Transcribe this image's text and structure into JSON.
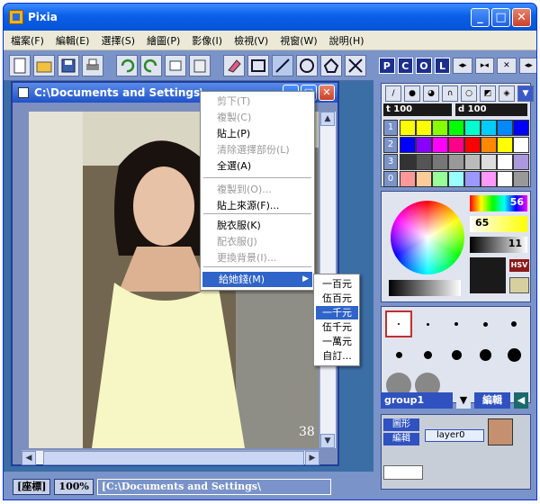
{
  "app": {
    "title": "Pixia"
  },
  "menu": [
    "檔案(F)",
    "編輯(E)",
    "選擇(S)",
    "繪圖(P)",
    "影像(I)",
    "檢視(V)",
    "視窗(W)",
    "說明(H)"
  ],
  "right_toolbar": {
    "p": "P",
    "c": "C",
    "o": "O",
    "l": "L"
  },
  "document": {
    "title": "C:\\Documents and Settings\\",
    "photo_label": "38"
  },
  "status": {
    "coord": "[座標]",
    "zoom": "100%",
    "path": "[C:\\Documents and Settings\\"
  },
  "color_panel": {
    "t_label": "t",
    "t_value": "100",
    "d_label": "d",
    "d_value": "100",
    "row_labels": [
      "1",
      "2",
      "3",
      "0"
    ],
    "r_value": "56",
    "g_value": "65",
    "b_value": "11",
    "mode": "HSV"
  },
  "layer_panel": {
    "group": "group1",
    "edit": "編輯",
    "shape": "圖形",
    "edit2": "編輯",
    "layer_name": "layer0"
  },
  "context_menu": {
    "items": [
      {
        "label": "剪下(T)",
        "disabled": true
      },
      {
        "label": "複製(C)",
        "disabled": true
      },
      {
        "label": "貼上(P)",
        "disabled": false
      },
      {
        "label": "清除選擇部份(L)",
        "disabled": true
      },
      {
        "label": "全選(A)",
        "disabled": false
      },
      {
        "label": "複製到(O)...",
        "disabled": true
      },
      {
        "label": "貼上來源(F)...",
        "disabled": false
      },
      {
        "label": "脫衣服(K)",
        "disabled": false
      },
      {
        "label": "配衣服(J)",
        "disabled": true
      },
      {
        "label": "更換背景(I)...",
        "disabled": true
      },
      {
        "label": "給她錢(M)",
        "disabled": false
      }
    ]
  },
  "submenu": {
    "items": [
      "一百元",
      "伍百元",
      "一千元",
      "伍千元",
      "一萬元",
      "自訂..."
    ],
    "selected": "一千元"
  }
}
